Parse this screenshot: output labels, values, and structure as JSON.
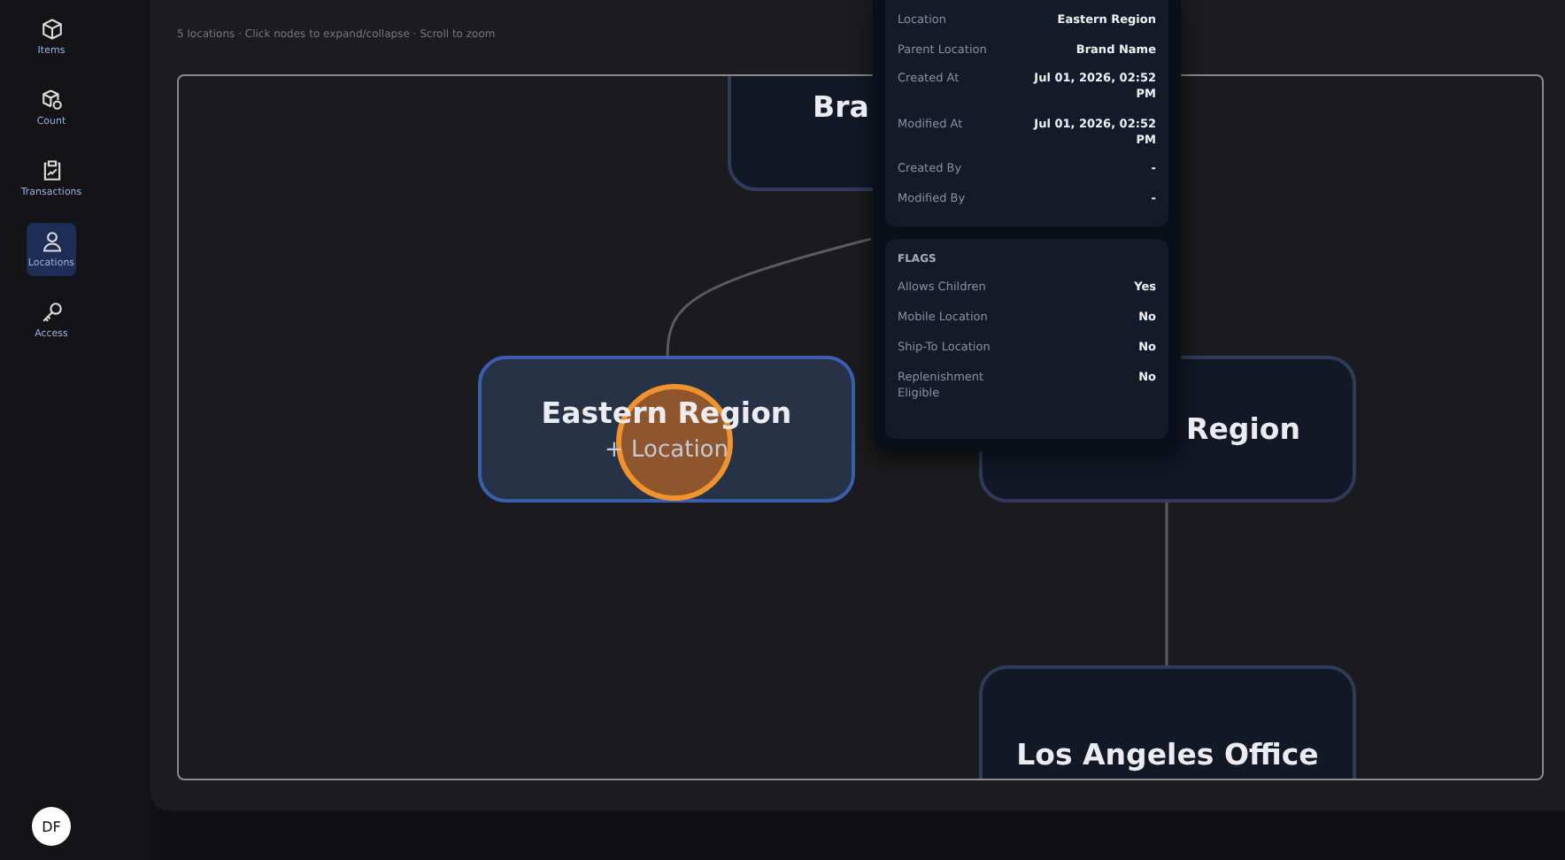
{
  "sidebar": {
    "items": [
      {
        "label": "Items",
        "selected": false
      },
      {
        "label": "Count",
        "selected": false
      },
      {
        "label": "Transactions",
        "selected": false
      },
      {
        "label": "Locations",
        "selected": true
      },
      {
        "label": "Access",
        "selected": false
      }
    ],
    "avatar": "DF"
  },
  "hint": "5 locations · Click nodes to expand/collapse · Scroll to zoom",
  "nodes": [
    {
      "label": "Bra",
      "selected": false
    },
    {
      "label": "Eastern Region",
      "action": "+ Location",
      "selected": true
    },
    {
      "label": "Region",
      "selected": false
    },
    {
      "label": "Los Angeles Office",
      "selected": false
    }
  ],
  "details": {
    "rows": [
      {
        "label": "Location",
        "value": "Eastern Region"
      },
      {
        "label": "Parent Location",
        "value": "Brand Name"
      },
      {
        "label": "Created At",
        "value": "Jul 01, 2026, 02:52 PM"
      },
      {
        "label": "Modified At",
        "value": "Jul 01, 2026, 02:52 PM"
      },
      {
        "label": "Created By",
        "value": "-"
      },
      {
        "label": "Modified By",
        "value": "-"
      }
    ]
  },
  "flags": {
    "title": "FLAGS",
    "rows": [
      {
        "label": "Allows Children",
        "value": "Yes"
      },
      {
        "label": "Mobile Location",
        "value": "No"
      },
      {
        "label": "Ship-To Location",
        "value": "No"
      },
      {
        "label": "Replenishment Eligible",
        "value": "No"
      }
    ]
  }
}
